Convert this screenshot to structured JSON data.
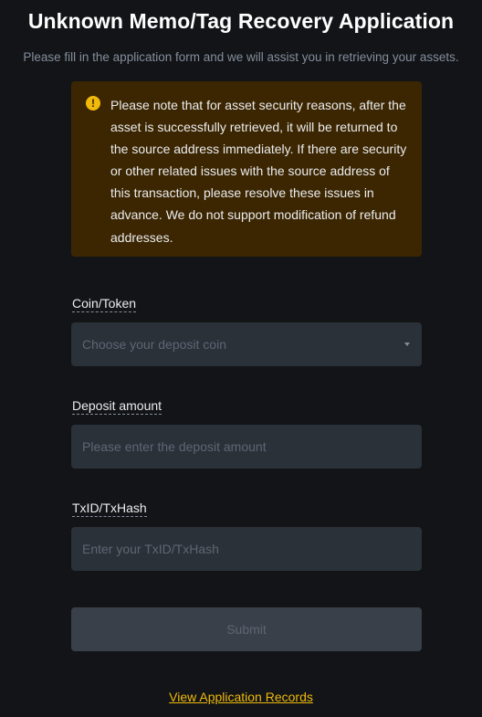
{
  "header": {
    "title": "Unknown Memo/Tag Recovery Application",
    "subtitle": "Please fill in the application form and we will assist you in retrieving your assets."
  },
  "notice": {
    "icon": "warning-icon",
    "icon_glyph": "!",
    "text": "Please note that for asset security reasons, after the asset is successfully retrieved, it will be returned to the source address immediately. If there are security or other related issues with the source address of this transaction, please resolve these issues in advance. We do not support modification of refund addresses."
  },
  "form": {
    "coin": {
      "label": "Coin/Token",
      "placeholder": "Choose your deposit coin"
    },
    "amount": {
      "label": "Deposit amount",
      "placeholder": "Please enter the deposit amount"
    },
    "txid": {
      "label": "TxID/TxHash",
      "placeholder": "Enter your TxID/TxHash"
    },
    "submit_label": "Submit"
  },
  "footer": {
    "records_link": "View Application Records"
  },
  "colors": {
    "background": "#121417",
    "notice_background": "#3c2601",
    "accent": "#f0b90b",
    "input_background": "#2b3139",
    "placeholder": "#5e6673"
  }
}
